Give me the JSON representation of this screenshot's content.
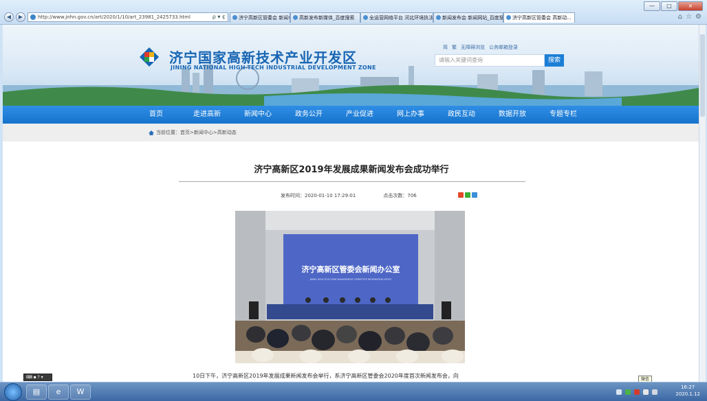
{
  "browser": {
    "address": "http://www.jnhn.gov.cn/art/2020/1/10/art_23981_2425733.html",
    "address_tools": "ρ ▾ ¢",
    "tabs": [
      {
        "label": "济宁高新区管委会 新闻中..."
      },
      {
        "label": "高新发布新媒体_百度搜索"
      },
      {
        "label": "全运营网络平台 河北环境执法..."
      },
      {
        "label": "新闻发布会 新闻网站_百度搜索"
      },
      {
        "label": "济宁高新区管委会 高新动..."
      }
    ],
    "window_buttons": [
      "—",
      "□",
      "×"
    ],
    "right_icons": [
      "⌂",
      "☆",
      "⚙"
    ]
  },
  "site": {
    "title": "济宁国家高新技术产业开发区",
    "subtitle": "JINING NATIONAL HIGH-TECH INDUSTRIAL DEVELOPMENT ZONE",
    "top_links": [
      "简",
      "繁",
      "无障碍浏览",
      "公务邮箱登录"
    ],
    "search_placeholder": "请输入关键词查询",
    "search_button": "搜索",
    "nav": [
      "首页",
      "走进高新",
      "新闻中心",
      "政务公开",
      "产业促进",
      "网上办事",
      "政民互动",
      "数据开放",
      "专题专栏"
    ],
    "breadcrumb": "当前位置：首页>新闻中心>高新动态"
  },
  "article": {
    "title": "济宁高新区2019年发展成果新闻发布会成功举行",
    "publish_time": "发布时间：2020-01-10 17:29:01",
    "views": "点击次数：706",
    "photo_banner_title": "济宁高新区管委会新闻办公室",
    "photo_banner_sub": "JINING HIGH-TECH ZONE MANAGEMENT COMMITTEE INFORMATION OFFICE",
    "paragraph": "10日下午，济宁高新区2019年发展成果新闻发布会举行，系济宁高新区管委会2020年度首次新闻发布会，向"
  },
  "taskbar": {
    "lang_bar": "⌨ ▪ ? ▾",
    "tooltip": "微信",
    "clock_time": "16:27",
    "clock_date": "2020.1.12"
  },
  "colors": {
    "brand_blue": "#1765b3",
    "nav_blue": "#1f7fd6",
    "search_blue": "#1c7fd6"
  }
}
